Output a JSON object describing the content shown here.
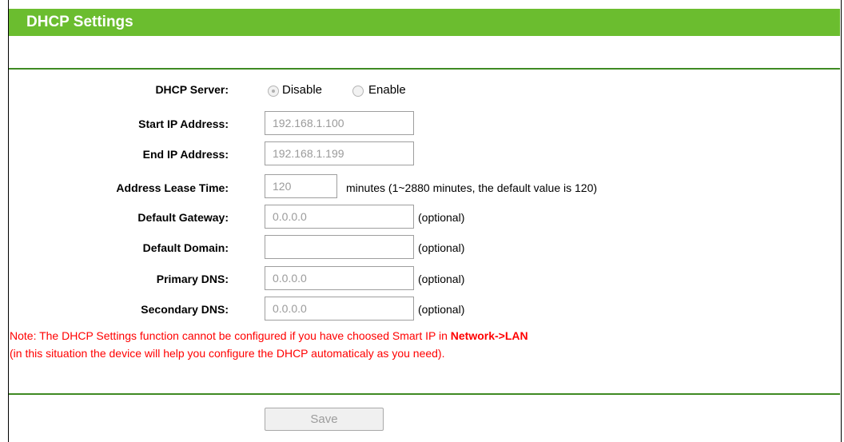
{
  "header": {
    "title": "DHCP Settings"
  },
  "dhcp_server": {
    "label": "DHCP Server:",
    "options": [
      "Disable",
      "Enable"
    ],
    "selected": "Disable"
  },
  "start_ip": {
    "label": "Start IP Address:",
    "value": "192.168.1.100"
  },
  "end_ip": {
    "label": "End IP Address:",
    "value": "192.168.1.199"
  },
  "lease_time": {
    "label": "Address Lease Time:",
    "value": "120",
    "hint": "minutes (1~2880 minutes, the default value is 120)"
  },
  "default_gateway": {
    "label": "Default Gateway:",
    "value": "0.0.0.0",
    "hint": "(optional)"
  },
  "default_domain": {
    "label": "Default Domain:",
    "value": "",
    "hint": "(optional)"
  },
  "primary_dns": {
    "label": "Primary DNS:",
    "value": "0.0.0.0",
    "hint": "(optional)"
  },
  "secondary_dns": {
    "label": "Secondary DNS:",
    "value": "0.0.0.0",
    "hint": "(optional)"
  },
  "note": {
    "line1_text": "Note: The DHCP Settings function cannot be configured if you have choosed Smart IP in ",
    "line1_link": "Network->LAN",
    "line2_text": "(in this situation the device will help you configure the DHCP automaticaly as you need)."
  },
  "save_label": "Save"
}
